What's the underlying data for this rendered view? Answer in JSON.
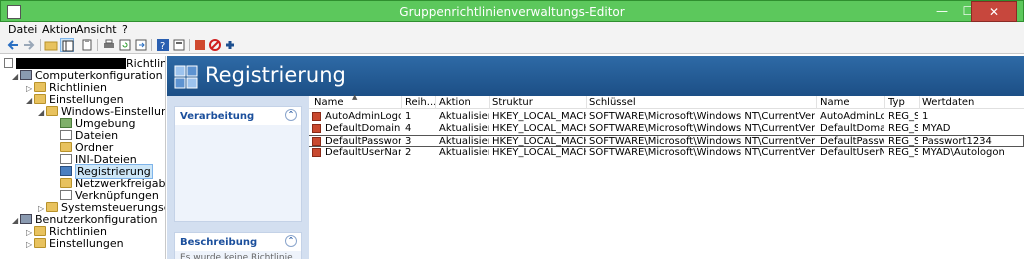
{
  "window": {
    "title": "Gruppenrichtlinienverwaltungs-Editor",
    "min_label": "—",
    "max_label": "☐",
    "close_label": "✕"
  },
  "menu": {
    "items": [
      "Datei",
      "Aktion",
      "Ansicht",
      "?"
    ]
  },
  "toolbar": {
    "icons": [
      "back-icon",
      "forward-icon",
      "up-folder-icon",
      "show-hide-tree-icon",
      "clipboard-icon",
      "print-icon",
      "refresh-icon",
      "export-icon",
      "help-icon",
      "properties-icon",
      "new-item-icon",
      "delete-icon",
      "add-icon"
    ]
  },
  "tree": {
    "root_suffix": "Richtlinie",
    "items": [
      {
        "label": "Computerkonfiguration"
      },
      {
        "label": "Richtlinien"
      },
      {
        "label": "Einstellungen"
      },
      {
        "label": "Windows-Einstellungen"
      },
      {
        "label": "Umgebung"
      },
      {
        "label": "Dateien"
      },
      {
        "label": "Ordner"
      },
      {
        "label": "INI-Dateien"
      },
      {
        "label": "Registrierung"
      },
      {
        "label": "Netzwerkfreigaben"
      },
      {
        "label": "Verknüpfungen"
      },
      {
        "label": "Systemsteuerungseinstellung"
      },
      {
        "label": "Benutzerkonfiguration"
      },
      {
        "label": "Richtlinien"
      },
      {
        "label": "Einstellungen"
      }
    ]
  },
  "header": {
    "title": "Registrierung"
  },
  "sidebar": {
    "processing_title": "Verarbeitung",
    "description_title": "Beschreibung",
    "description_text": "Es wurde keine Richtlinie"
  },
  "table": {
    "columns": [
      "Name",
      "Reih...",
      "Aktion",
      "Struktur",
      "Schlüssel",
      "Name",
      "Typ",
      "Wertdaten"
    ],
    "rows": [
      [
        "AutoAdminLogon",
        "1",
        "Aktualisieren",
        "HKEY_LOCAL_MACHINE",
        "SOFTWARE\\Microsoft\\Windows NT\\CurrentVersion\\Winlogon",
        "AutoAdminLo...",
        "REG_SZ",
        "1"
      ],
      [
        "DefaultDomainName",
        "4",
        "Aktualisieren",
        "HKEY_LOCAL_MACHINE",
        "SOFTWARE\\Microsoft\\Windows NT\\CurrentVersion\\Winlogon",
        "DefaultDomai...",
        "REG_SZ",
        "MYAD"
      ],
      [
        "DefaultPassword",
        "3",
        "Aktualisieren",
        "HKEY_LOCAL_MACHINE",
        "SOFTWARE\\Microsoft\\Windows NT\\CurrentVersion\\Winlogon",
        "DefaultPassword",
        "REG_SZ",
        "Passwort1234"
      ],
      [
        "DefaultUserName",
        "2",
        "Aktualisieren",
        "HKEY_LOCAL_MACHINE",
        "SOFTWARE\\Microsoft\\Windows NT\\CurrentVersion\\Winlogon",
        "DefaultUserNa...",
        "REG_SZ",
        "MYAD\\Autologon"
      ]
    ]
  },
  "colors": {
    "titlebar": "#5cc85c",
    "header": "#2e6aa6",
    "selection": "#cde6f7"
  }
}
